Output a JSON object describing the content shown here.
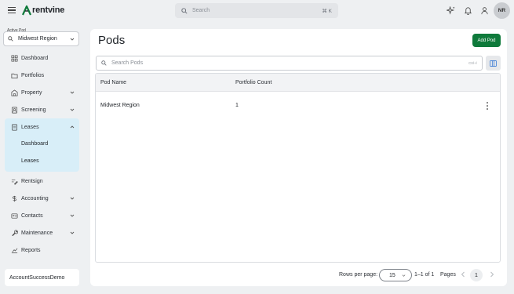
{
  "brand": {
    "name": "rentvine"
  },
  "top_search": {
    "placeholder": "Search",
    "shortcut": "⌘ K"
  },
  "user": {
    "initials": "NR"
  },
  "sidebar": {
    "active_pod_label": "Active Pod",
    "active_pod_value": "Midwest Region",
    "items": [
      {
        "label": "Dashboard",
        "icon": "dashboard-icon"
      },
      {
        "label": "Portfolios",
        "icon": "folder-icon"
      },
      {
        "label": "Property",
        "icon": "building-icon"
      },
      {
        "label": "Screening",
        "icon": "screening-icon"
      },
      {
        "label": "Leases",
        "icon": "lease-icon"
      },
      {
        "label": "Rentsign",
        "icon": "signature-icon"
      },
      {
        "label": "Accounting",
        "icon": "dollar-icon"
      },
      {
        "label": "Contacts",
        "icon": "contact-card-icon"
      },
      {
        "label": "Maintenance",
        "icon": "wrench-icon"
      },
      {
        "label": "Reports",
        "icon": "chart-icon"
      }
    ],
    "lease_subitems": [
      {
        "label": "Dashboard"
      },
      {
        "label": "Leases"
      }
    ],
    "account_name": "AccountSuccessDemo"
  },
  "main": {
    "title": "Pods",
    "add_button": "Add Pod",
    "search": {
      "placeholder": "Search Pods",
      "shortcut": "Ctrl+/"
    },
    "columns": [
      "Pod Name",
      "Portfolio Count"
    ],
    "rows": [
      {
        "pod_name": "Midwest Region",
        "portfolio_count": "1"
      }
    ],
    "footer": {
      "rows_per_page_label": "Rows per page:",
      "rows_per_page_value": "15",
      "range": "1–1 of 1",
      "pages_label": "Pages",
      "current_page": "1"
    }
  },
  "colors": {
    "accent_green": "#0f7a3b",
    "active_nav_bg": "#d8eef8",
    "page_bg": "#eef0f2"
  }
}
